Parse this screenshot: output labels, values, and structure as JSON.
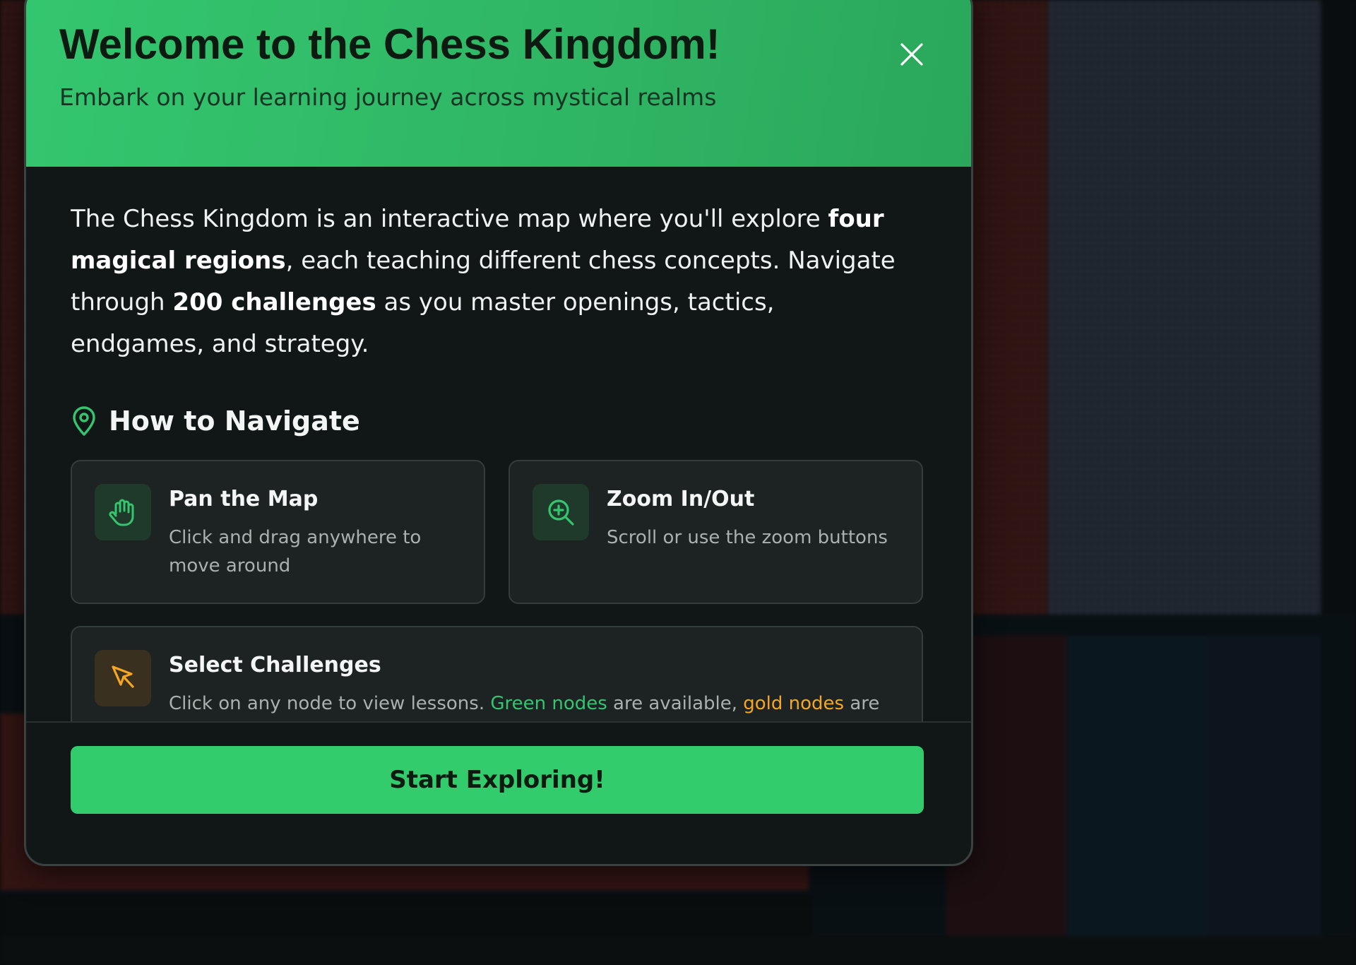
{
  "modal": {
    "title": "Welcome to the Chess Kingdom!",
    "subtitle": "Embark on your learning journey across mystical realms",
    "intro": {
      "part1": "The Chess Kingdom is an interactive map where you'll explore ",
      "bold1": "four magical regions",
      "part2": ", each teaching different chess concepts. Navigate through ",
      "bold2": "200 challenges",
      "part3": " as you master openings, tactics, endgames, and strategy."
    },
    "navigate": {
      "title": "How to Navigate",
      "cards": [
        {
          "title": "Pan the Map",
          "description": "Click and drag anywhere to move around",
          "icon": "hand-icon"
        },
        {
          "title": "Zoom In/Out",
          "description": "Scroll or use the zoom buttons",
          "icon": "zoom-in-icon"
        },
        {
          "title": "Select Challenges",
          "icon": "cursor-icon",
          "desc_part1": "Click on any node to view lessons. ",
          "desc_green": "Green nodes",
          "desc_part2": " are available, ",
          "desc_gold": "gold nodes",
          "desc_part3": " are"
        }
      ]
    },
    "start_button": "Start Exploring!"
  },
  "colors": {
    "accent": "#34c66f",
    "gold": "#f5a623",
    "modal_bg": "#111616",
    "card_bg": "#1d2222"
  }
}
